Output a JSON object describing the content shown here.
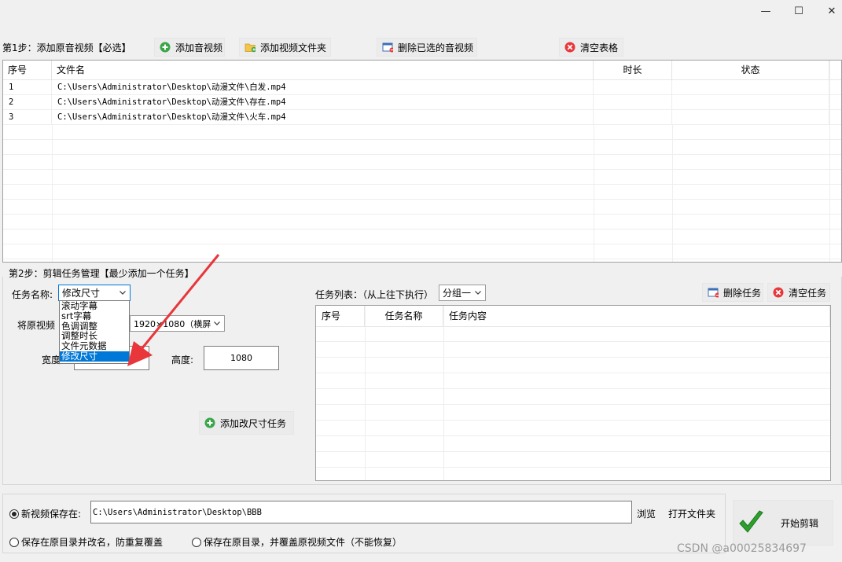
{
  "window": {
    "minimize_glyph": "—",
    "maximize_glyph": "☐",
    "close_glyph": "✕"
  },
  "step1": {
    "label": "第1步：添加原音视频【必选】",
    "buttons": {
      "add_media": "添加音视频",
      "add_folder": "添加视频文件夹",
      "delete_selected": "删除已选的音视频",
      "clear_table": "清空表格"
    }
  },
  "file_table": {
    "columns": [
      "序号",
      "文件名",
      "时长",
      "状态"
    ],
    "rows": [
      {
        "index": "1",
        "name": "C:\\Users\\Administrator\\Desktop\\动漫文件\\白发.mp4",
        "duration": "",
        "status": ""
      },
      {
        "index": "2",
        "name": "C:\\Users\\Administrator\\Desktop\\动漫文件\\存在.mp4",
        "duration": "",
        "status": ""
      },
      {
        "index": "3",
        "name": "C:\\Users\\Administrator\\Desktop\\动漫文件\\火车.mp4",
        "duration": "",
        "status": ""
      }
    ]
  },
  "step2": {
    "label": "第2步：剪辑任务管理【最少添加一个任务】",
    "task_name_label": "任务名称:",
    "task_name_value": "修改尺寸",
    "task_options": [
      "滚动字幕",
      "srt字幕",
      "色调调整",
      "调整时长",
      "文件元数据",
      "修改尺寸"
    ],
    "selected_option": "修改尺寸",
    "resize_label_prefix": "将原视频",
    "resolution_value": "1920×1080（横屏",
    "width_label": "宽度",
    "width_value": "",
    "height_label": "高度:",
    "height_value": "1080",
    "add_task_button": "添加改尺寸任务",
    "task_list_label": "任务列表：（从上往下执行）",
    "group_value": "分组一",
    "delete_task_button": "删除任务",
    "clear_tasks_button": "清空任务",
    "task_columns": [
      "序号",
      "任务名称",
      "任务内容"
    ]
  },
  "output": {
    "save_new_label": "新视频保存在:",
    "save_path": "C:\\Users\\Administrator\\Desktop\\BBB",
    "browse": "浏览",
    "open_folder": "打开文件夹",
    "save_rename_label": "保存在原目录并改名，防重复覆盖",
    "save_overwrite_label": "保存在原目录，并覆盖原视频文件（不能恢复）",
    "start_button": "开始剪辑"
  },
  "watermark": "CSDN @a00025834697",
  "colors": {
    "selection": "#0078d7",
    "arrow_annotation": "#e8363a",
    "check_green": "#2e9e2e"
  }
}
